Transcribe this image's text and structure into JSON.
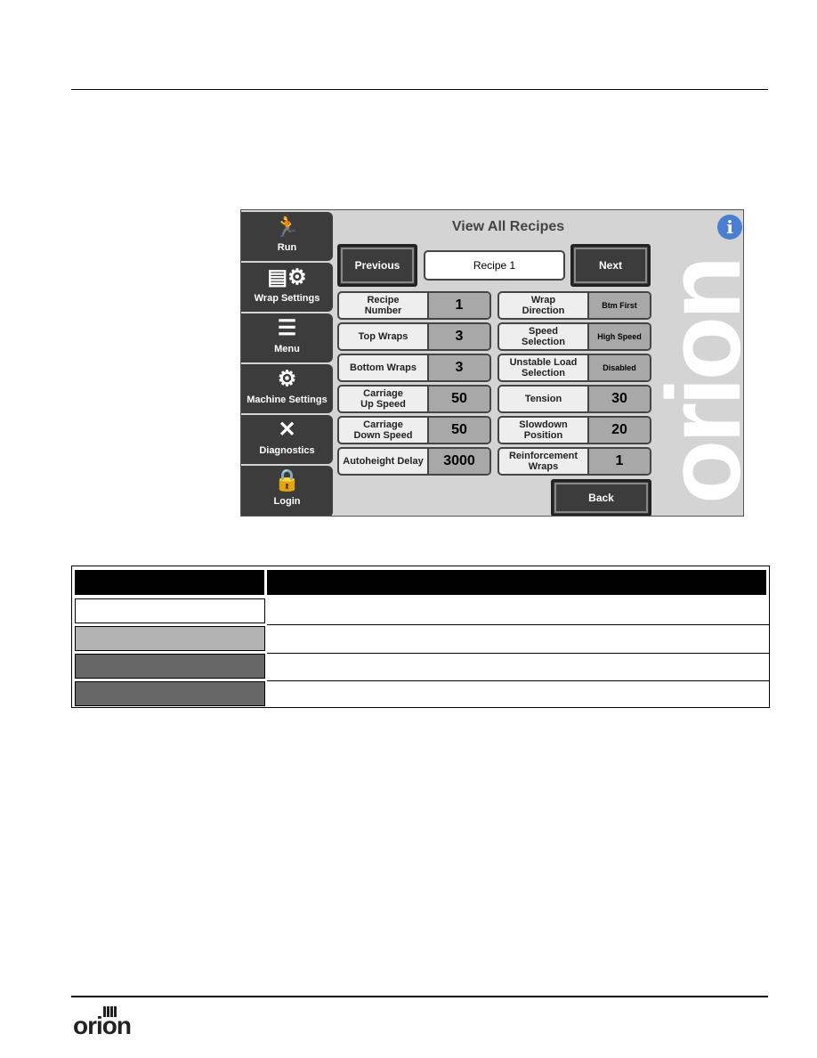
{
  "screen": {
    "title": "View All Recipes",
    "sidebar": [
      {
        "label": "Run",
        "icon": "running-man-icon"
      },
      {
        "label": "Wrap Settings",
        "icon": "wrap-gear-icon"
      },
      {
        "label": "Menu",
        "icon": "hamburger-menu-icon"
      },
      {
        "label": "Machine Settings",
        "icon": "gear-icon"
      },
      {
        "label": "Diagnostics",
        "icon": "wrench-screwdriver-icon"
      },
      {
        "label": "Login",
        "icon": "lock-icon"
      }
    ],
    "previous_label": "Previous",
    "recipe_value": "Recipe 1",
    "next_label": "Next",
    "back_label": "Back",
    "left_fields": [
      {
        "label": "Recipe\nNumber",
        "value": "1"
      },
      {
        "label": "Top Wraps",
        "value": "3"
      },
      {
        "label": "Bottom Wraps",
        "value": "3"
      },
      {
        "label": "Carriage\nUp Speed",
        "value": "50"
      },
      {
        "label": "Carriage\nDown Speed",
        "value": "50"
      },
      {
        "label": "Autoheight Delay",
        "value": "3000"
      }
    ],
    "right_fields": [
      {
        "label": "Wrap\nDirection",
        "value": "Btm First"
      },
      {
        "label": "Speed\nSelection",
        "value": "High Speed"
      },
      {
        "label": "Unstable Load\nSelection",
        "value": "Disabled"
      },
      {
        "label": "Tension",
        "value": "30"
      },
      {
        "label": "Slowdown\nPosition",
        "value": "20"
      },
      {
        "label": "Reinforcement\nWraps",
        "value": "1"
      }
    ],
    "logo_text": "orion"
  },
  "legend_swatches": [
    "#ffffff",
    "#b3b3b3",
    "#666666",
    "#666666"
  ],
  "footer": {
    "logo_text": "orion"
  }
}
